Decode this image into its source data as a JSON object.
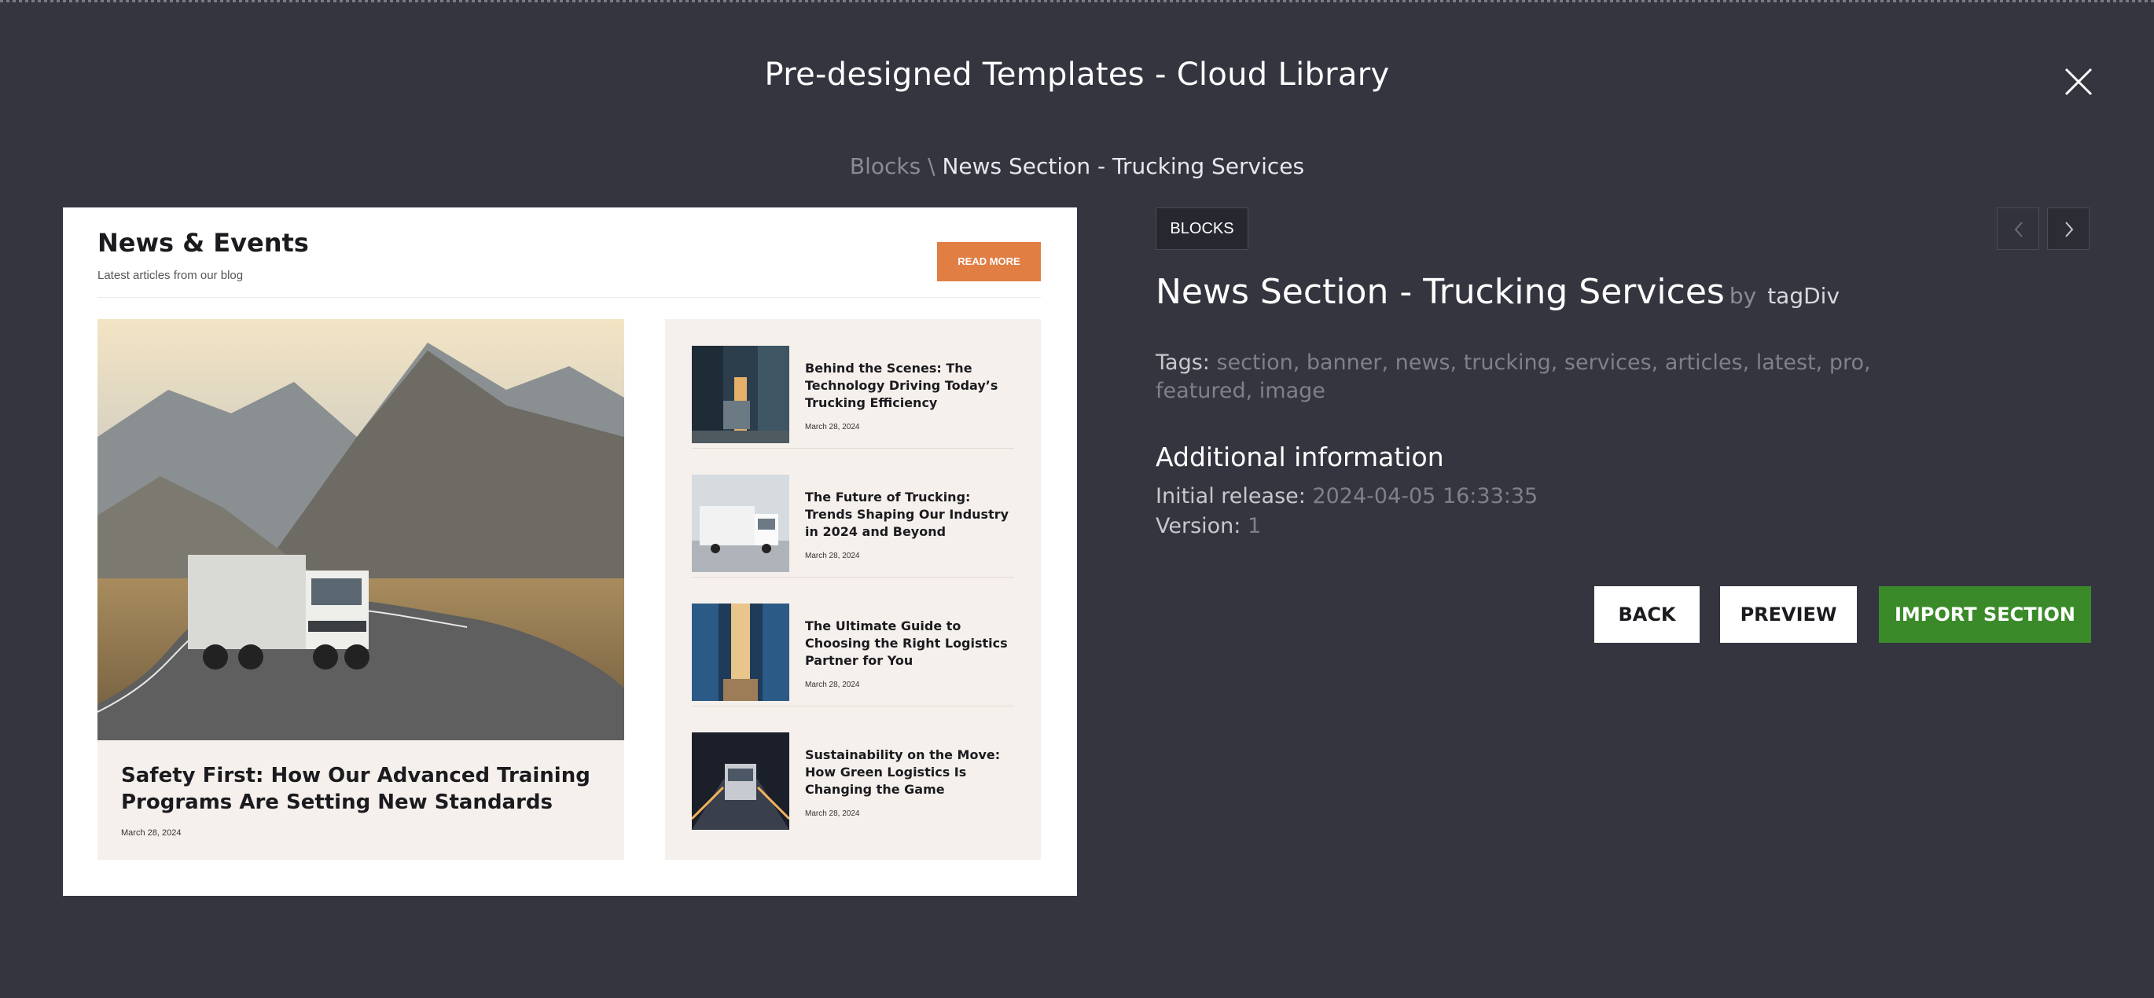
{
  "modal": {
    "title": "Pre-designed Templates - Cloud Library"
  },
  "breadcrumb": {
    "root": "Blocks",
    "separator": "\\",
    "current": "News Section - Trucking Services"
  },
  "preview": {
    "heading": "News & Events",
    "subheading": "Latest articles from our blog",
    "read_more": "READ MORE",
    "featured": {
      "title": "Safety First: How Our Advanced Training Programs Are Setting New Standards",
      "date": "March 28, 2024"
    },
    "articles": [
      {
        "title": "Behind the Scenes: The Technology Driving Today’s Trucking Efficiency",
        "date": "March 28, 2024"
      },
      {
        "title": "The Future of Trucking: Trends Shaping Our Industry in 2024 and Beyond",
        "date": "March 28, 2024"
      },
      {
        "title": "The Ultimate Guide to Choosing the Right Logistics Partner for You",
        "date": "March 28, 2024"
      },
      {
        "title": "Sustainability on the Move: How Green Logistics Is Changing the Game",
        "date": "March 28, 2024"
      }
    ]
  },
  "info": {
    "category": "BLOCKS",
    "title": "News Section - Trucking Services",
    "by": "by",
    "author": "tagDiv",
    "tags_label": "Tags:",
    "tags_value": "section, banner, news, trucking, services, articles, latest, pro, featured, image",
    "additional_title": "Additional information",
    "release_label": "Initial release:",
    "release_value": "2024-04-05 16:33:35",
    "version_label": "Version:",
    "version_value": "1"
  },
  "actions": {
    "back": "BACK",
    "preview": "PREVIEW",
    "import": "IMPORT SECTION"
  },
  "icons": {
    "close": "close-icon",
    "prev": "chevron-left-icon",
    "next": "chevron-right-icon"
  },
  "colors": {
    "background": "#34353f",
    "accent_orange": "#e07e44",
    "import_green": "#3b8a2a"
  }
}
